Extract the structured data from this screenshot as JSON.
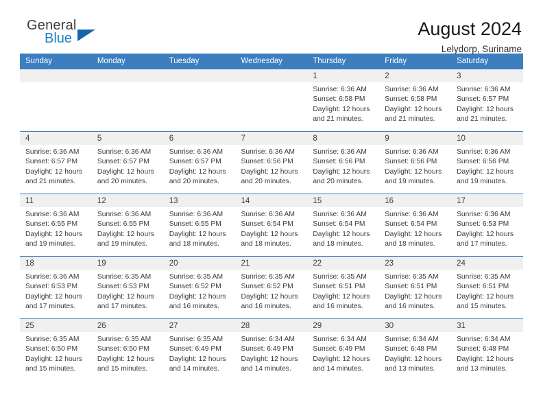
{
  "brand": {
    "name_top": "General",
    "name_bottom": "Blue",
    "triangle_color": "#1565a8",
    "blue_color": "#1f7ec4"
  },
  "header": {
    "title": "August 2024",
    "subtitle": "Lelydorp, Suriname"
  },
  "theme": {
    "header_blue": "#3c7ebf",
    "daynum_band": "#f0f0f0",
    "text": "#3a3a3a"
  },
  "weekdays": [
    "Sunday",
    "Monday",
    "Tuesday",
    "Wednesday",
    "Thursday",
    "Friday",
    "Saturday"
  ],
  "labels": {
    "sunrise_prefix": "Sunrise:",
    "sunset_prefix": "Sunset:",
    "daylight_prefix": "Daylight:"
  },
  "weeks": [
    [
      {
        "day": "",
        "line1": "",
        "line2": "",
        "line3": "",
        "line4": ""
      },
      {
        "day": "",
        "line1": "",
        "line2": "",
        "line3": "",
        "line4": ""
      },
      {
        "day": "",
        "line1": "",
        "line2": "",
        "line3": "",
        "line4": ""
      },
      {
        "day": "",
        "line1": "",
        "line2": "",
        "line3": "",
        "line4": ""
      },
      {
        "day": "1",
        "line1": "Sunrise: 6:36 AM",
        "line2": "Sunset: 6:58 PM",
        "line3": "Daylight: 12 hours",
        "line4": "and 21 minutes."
      },
      {
        "day": "2",
        "line1": "Sunrise: 6:36 AM",
        "line2": "Sunset: 6:58 PM",
        "line3": "Daylight: 12 hours",
        "line4": "and 21 minutes."
      },
      {
        "day": "3",
        "line1": "Sunrise: 6:36 AM",
        "line2": "Sunset: 6:57 PM",
        "line3": "Daylight: 12 hours",
        "line4": "and 21 minutes."
      }
    ],
    [
      {
        "day": "4",
        "line1": "Sunrise: 6:36 AM",
        "line2": "Sunset: 6:57 PM",
        "line3": "Daylight: 12 hours",
        "line4": "and 21 minutes."
      },
      {
        "day": "5",
        "line1": "Sunrise: 6:36 AM",
        "line2": "Sunset: 6:57 PM",
        "line3": "Daylight: 12 hours",
        "line4": "and 20 minutes."
      },
      {
        "day": "6",
        "line1": "Sunrise: 6:36 AM",
        "line2": "Sunset: 6:57 PM",
        "line3": "Daylight: 12 hours",
        "line4": "and 20 minutes."
      },
      {
        "day": "7",
        "line1": "Sunrise: 6:36 AM",
        "line2": "Sunset: 6:56 PM",
        "line3": "Daylight: 12 hours",
        "line4": "and 20 minutes."
      },
      {
        "day": "8",
        "line1": "Sunrise: 6:36 AM",
        "line2": "Sunset: 6:56 PM",
        "line3": "Daylight: 12 hours",
        "line4": "and 20 minutes."
      },
      {
        "day": "9",
        "line1": "Sunrise: 6:36 AM",
        "line2": "Sunset: 6:56 PM",
        "line3": "Daylight: 12 hours",
        "line4": "and 19 minutes."
      },
      {
        "day": "10",
        "line1": "Sunrise: 6:36 AM",
        "line2": "Sunset: 6:56 PM",
        "line3": "Daylight: 12 hours",
        "line4": "and 19 minutes."
      }
    ],
    [
      {
        "day": "11",
        "line1": "Sunrise: 6:36 AM",
        "line2": "Sunset: 6:55 PM",
        "line3": "Daylight: 12 hours",
        "line4": "and 19 minutes."
      },
      {
        "day": "12",
        "line1": "Sunrise: 6:36 AM",
        "line2": "Sunset: 6:55 PM",
        "line3": "Daylight: 12 hours",
        "line4": "and 19 minutes."
      },
      {
        "day": "13",
        "line1": "Sunrise: 6:36 AM",
        "line2": "Sunset: 6:55 PM",
        "line3": "Daylight: 12 hours",
        "line4": "and 18 minutes."
      },
      {
        "day": "14",
        "line1": "Sunrise: 6:36 AM",
        "line2": "Sunset: 6:54 PM",
        "line3": "Daylight: 12 hours",
        "line4": "and 18 minutes."
      },
      {
        "day": "15",
        "line1": "Sunrise: 6:36 AM",
        "line2": "Sunset: 6:54 PM",
        "line3": "Daylight: 12 hours",
        "line4": "and 18 minutes."
      },
      {
        "day": "16",
        "line1": "Sunrise: 6:36 AM",
        "line2": "Sunset: 6:54 PM",
        "line3": "Daylight: 12 hours",
        "line4": "and 18 minutes."
      },
      {
        "day": "17",
        "line1": "Sunrise: 6:36 AM",
        "line2": "Sunset: 6:53 PM",
        "line3": "Daylight: 12 hours",
        "line4": "and 17 minutes."
      }
    ],
    [
      {
        "day": "18",
        "line1": "Sunrise: 6:36 AM",
        "line2": "Sunset: 6:53 PM",
        "line3": "Daylight: 12 hours",
        "line4": "and 17 minutes."
      },
      {
        "day": "19",
        "line1": "Sunrise: 6:35 AM",
        "line2": "Sunset: 6:53 PM",
        "line3": "Daylight: 12 hours",
        "line4": "and 17 minutes."
      },
      {
        "day": "20",
        "line1": "Sunrise: 6:35 AM",
        "line2": "Sunset: 6:52 PM",
        "line3": "Daylight: 12 hours",
        "line4": "and 16 minutes."
      },
      {
        "day": "21",
        "line1": "Sunrise: 6:35 AM",
        "line2": "Sunset: 6:52 PM",
        "line3": "Daylight: 12 hours",
        "line4": "and 16 minutes."
      },
      {
        "day": "22",
        "line1": "Sunrise: 6:35 AM",
        "line2": "Sunset: 6:51 PM",
        "line3": "Daylight: 12 hours",
        "line4": "and 16 minutes."
      },
      {
        "day": "23",
        "line1": "Sunrise: 6:35 AM",
        "line2": "Sunset: 6:51 PM",
        "line3": "Daylight: 12 hours",
        "line4": "and 16 minutes."
      },
      {
        "day": "24",
        "line1": "Sunrise: 6:35 AM",
        "line2": "Sunset: 6:51 PM",
        "line3": "Daylight: 12 hours",
        "line4": "and 15 minutes."
      }
    ],
    [
      {
        "day": "25",
        "line1": "Sunrise: 6:35 AM",
        "line2": "Sunset: 6:50 PM",
        "line3": "Daylight: 12 hours",
        "line4": "and 15 minutes."
      },
      {
        "day": "26",
        "line1": "Sunrise: 6:35 AM",
        "line2": "Sunset: 6:50 PM",
        "line3": "Daylight: 12 hours",
        "line4": "and 15 minutes."
      },
      {
        "day": "27",
        "line1": "Sunrise: 6:35 AM",
        "line2": "Sunset: 6:49 PM",
        "line3": "Daylight: 12 hours",
        "line4": "and 14 minutes."
      },
      {
        "day": "28",
        "line1": "Sunrise: 6:34 AM",
        "line2": "Sunset: 6:49 PM",
        "line3": "Daylight: 12 hours",
        "line4": "and 14 minutes."
      },
      {
        "day": "29",
        "line1": "Sunrise: 6:34 AM",
        "line2": "Sunset: 6:49 PM",
        "line3": "Daylight: 12 hours",
        "line4": "and 14 minutes."
      },
      {
        "day": "30",
        "line1": "Sunrise: 6:34 AM",
        "line2": "Sunset: 6:48 PM",
        "line3": "Daylight: 12 hours",
        "line4": "and 13 minutes."
      },
      {
        "day": "31",
        "line1": "Sunrise: 6:34 AM",
        "line2": "Sunset: 6:48 PM",
        "line3": "Daylight: 12 hours",
        "line4": "and 13 minutes."
      }
    ]
  ]
}
